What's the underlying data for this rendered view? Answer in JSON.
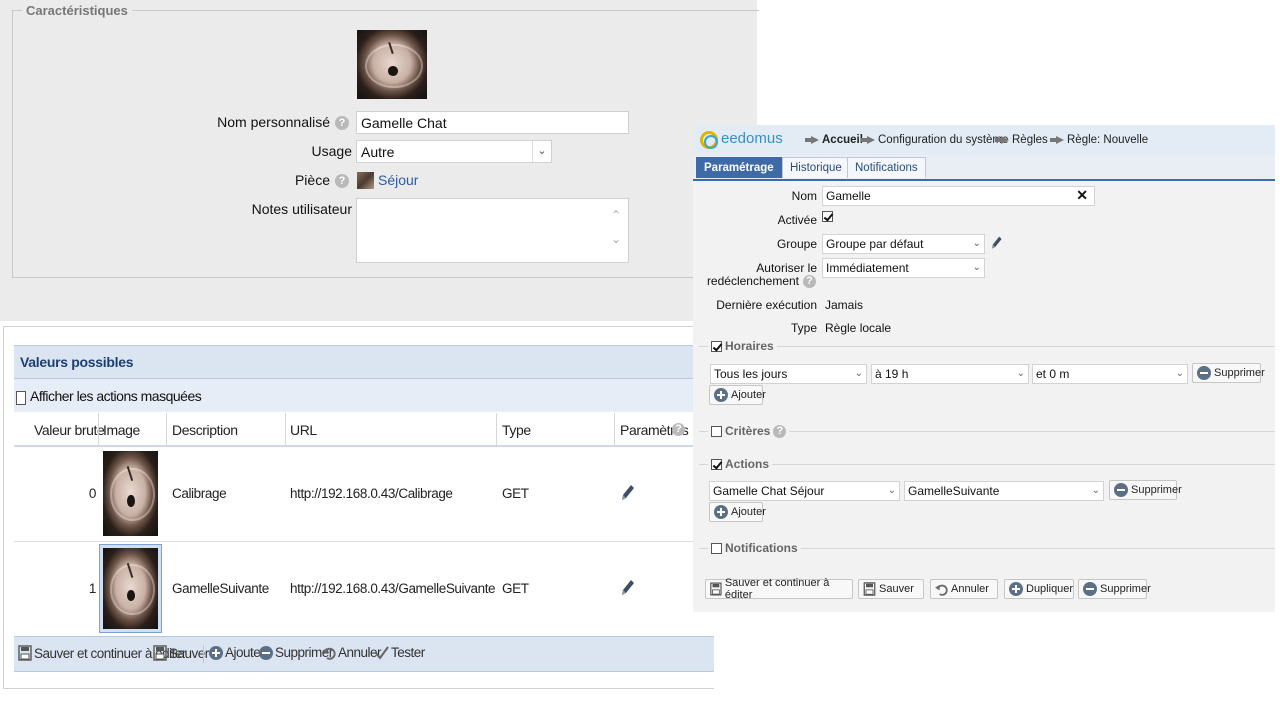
{
  "caracteristiques": {
    "legend": "Caractéristiques",
    "nom_label": "Nom personnalisé",
    "nom_value": "Gamelle Chat",
    "usage_label": "Usage",
    "usage_value": "Autre",
    "piece_label": "Pièce",
    "piece_value": "Séjour",
    "notes_label": "Notes utilisateur",
    "notes_value": ""
  },
  "valeurs": {
    "title": "Valeurs possibles",
    "show_hidden_label": "Afficher les actions masquées",
    "columns": [
      "Valeur brute",
      "Image",
      "Description",
      "URL",
      "Type",
      "Paramètres"
    ],
    "rows": [
      {
        "valeur": "0",
        "description": "Calibrage",
        "url": "http://192.168.0.43/Calibrage",
        "type": "GET"
      },
      {
        "valeur": "1",
        "description": "GamelleSuivante",
        "url": "http://192.168.0.43/GamelleSuivante",
        "type": "GET"
      }
    ],
    "footer": {
      "save_continue": "Sauver et continuer à éditer",
      "save": "Sauver",
      "add": "Ajouter",
      "delete": "Supprimer",
      "cancel": "Annuler",
      "test": "Tester"
    }
  },
  "eedomus": {
    "brand": "eedomus",
    "breadcrumb": [
      "Accueil",
      "Configuration du système",
      "Règles",
      "Règle: Nouvelle"
    ],
    "tabs": [
      "Paramétrage",
      "Historique",
      "Notifications"
    ],
    "form": {
      "nom_label": "Nom",
      "nom_value": "Gamelle",
      "activee_label": "Activée",
      "groupe_label": "Groupe",
      "groupe_value": "Groupe par défaut",
      "autoriser_label_1": "Autoriser le",
      "autoriser_label_2": "redéclenchement",
      "autoriser_value": "Immédiatement",
      "derniere_label": "Dernière exécution",
      "derniere_value": "Jamais",
      "type_label": "Type",
      "type_value": "Règle locale"
    },
    "horaires": {
      "label": "Horaires",
      "jours": "Tous les jours",
      "heure": "à 19 h",
      "minute": "et 0 m",
      "supprimer": "Supprimer",
      "ajouter": "Ajouter"
    },
    "criteres": {
      "label": "Critères"
    },
    "actions": {
      "label": "Actions",
      "device": "Gamelle Chat Séjour",
      "value": "GamelleSuivante",
      "supprimer": "Supprimer",
      "ajouter": "Ajouter"
    },
    "notifications": {
      "label": "Notifications"
    },
    "bottom_buttons": {
      "save_continue": "Sauver et continuer à éditer",
      "save": "Sauver",
      "cancel": "Annuler",
      "duplicate": "Dupliquer",
      "delete": "Supprimer"
    }
  }
}
